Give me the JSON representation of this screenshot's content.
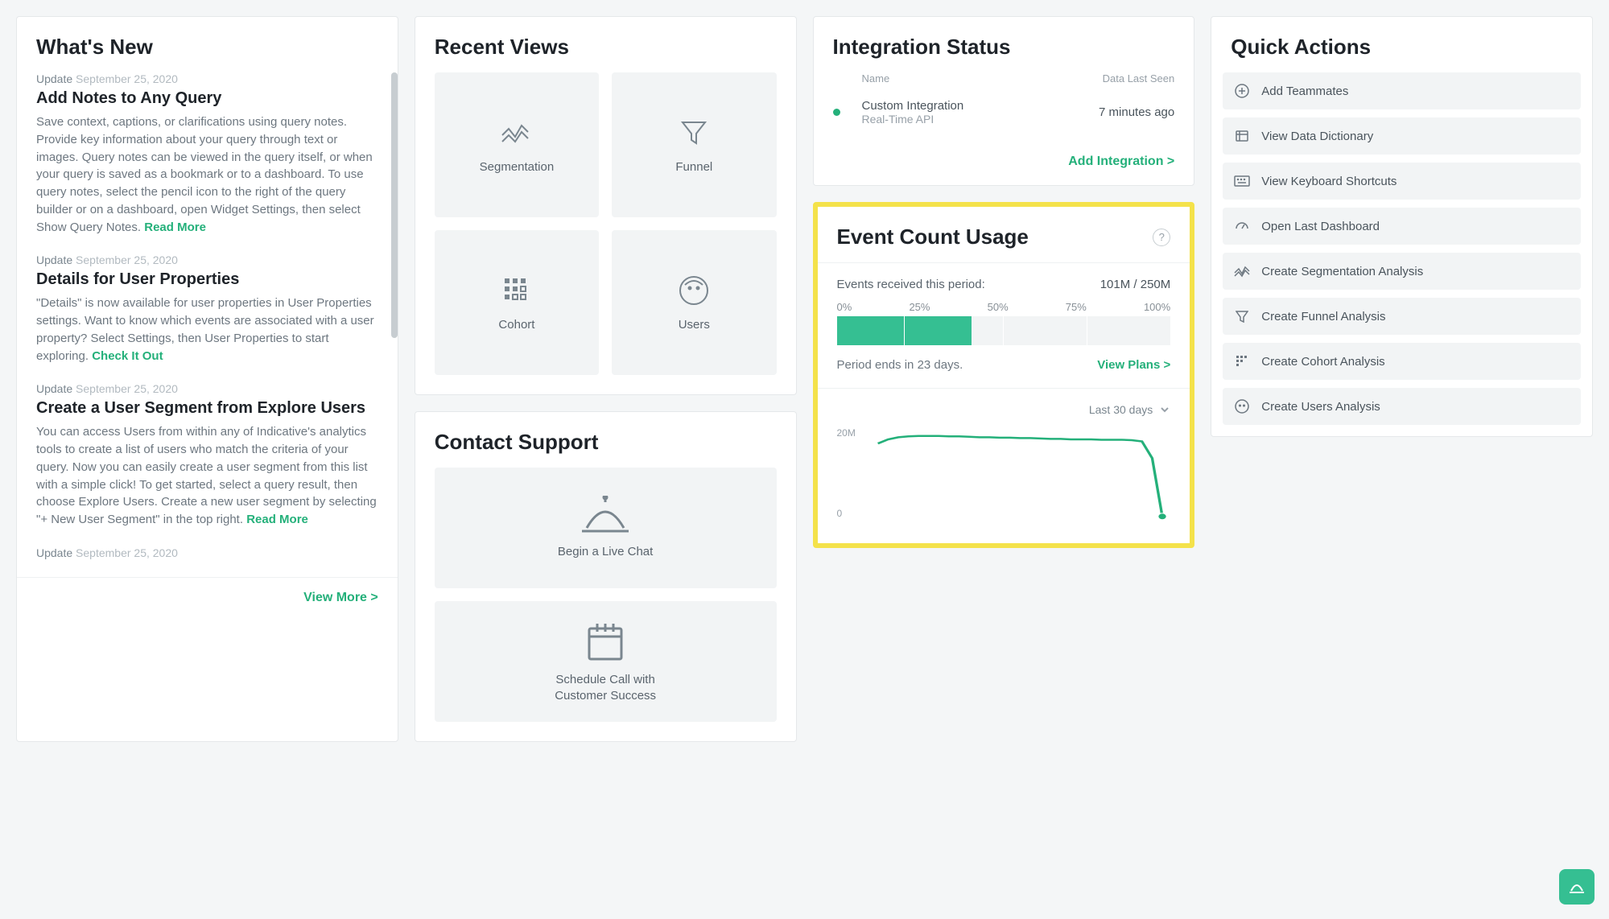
{
  "whats_new": {
    "title": "What's New",
    "view_more": "View More >",
    "items": [
      {
        "tag": "Update",
        "date": "September 25, 2020",
        "title": "Add Notes to Any Query",
        "body": "Save context, captions, or clarifications using query notes. Provide key information about your query through text or images. Query notes can be viewed in the query itself, or when your query is saved as a bookmark or to a dashboard. To use query notes, select the pencil icon to the right of the query builder or on a dashboard, open Widget Settings, then select Show Query Notes. ",
        "link": "Read More"
      },
      {
        "tag": "Update",
        "date": "September 25, 2020",
        "title": "Details for User Properties",
        "body": "\"Details\" is now available for user properties in User Properties settings. Want to know which events are associated with a user property? Select Settings, then User Properties to start exploring. ",
        "link": "Check It Out"
      },
      {
        "tag": "Update",
        "date": "September 25, 2020",
        "title": "Create a User Segment from Explore Users",
        "body": "You can access Users from within any of Indicative's analytics tools to create a list of users who match the criteria of your query. Now you can easily create a user segment from this list with a simple click! To get started, select a query result, then choose Explore Users. Create a new user segment by selecting \"+ New User Segment\" in the top right.  ",
        "link": "Read More"
      },
      {
        "tag": "Update",
        "date": "September 25, 2020",
        "title": "",
        "body": "",
        "link": ""
      }
    ]
  },
  "recent_views": {
    "title": "Recent Views",
    "tiles": [
      {
        "label": "Segmentation"
      },
      {
        "label": "Funnel"
      },
      {
        "label": "Cohort"
      },
      {
        "label": "Users"
      }
    ]
  },
  "contact_support": {
    "title": "Contact Support",
    "live_chat": "Begin a Live Chat",
    "schedule_line1": "Schedule Call with",
    "schedule_line2": "Customer Success"
  },
  "integration_status": {
    "title": "Integration Status",
    "col_name": "Name",
    "col_data": "Data Last Seen",
    "rows": [
      {
        "name": "Custom Integration",
        "sub": "Real-Time API",
        "time": "7 minutes ago"
      }
    ],
    "add": "Add Integration >"
  },
  "event_usage": {
    "title": "Event Count Usage",
    "events_label": "Events received this period:",
    "events_value": "101M / 250M",
    "ticks": [
      "0%",
      "25%",
      "50%",
      "75%",
      "100%"
    ],
    "fill_percent": 40.4,
    "period_text": "Period ends in 23 days.",
    "view_plans": "View Plans >",
    "range_label": "Last 30 days"
  },
  "chart_data": {
    "type": "line",
    "title": "",
    "xlabel": "",
    "ylabel": "",
    "ylim": [
      0,
      22
    ],
    "y_ticks": [
      "20M",
      "0"
    ],
    "x": [
      0,
      1,
      2,
      3,
      4,
      5,
      6,
      7,
      8,
      9,
      10,
      11,
      12,
      13,
      14,
      15,
      16,
      17,
      18,
      19,
      20,
      21,
      22,
      23,
      24,
      25,
      26,
      27,
      28
    ],
    "values": [
      18.5,
      19.5,
      20.0,
      20.2,
      20.3,
      20.3,
      20.3,
      20.2,
      20.2,
      20.1,
      20.0,
      20.0,
      19.9,
      19.9,
      19.8,
      19.8,
      19.7,
      19.6,
      19.6,
      19.5,
      19.5,
      19.5,
      19.4,
      19.4,
      19.4,
      19.3,
      19.0,
      15.0,
      1.0
    ]
  },
  "quick_actions": {
    "title": "Quick Actions",
    "items": [
      "Add Teammates",
      "View Data Dictionary",
      "View Keyboard Shortcuts",
      "Open Last Dashboard",
      "Create Segmentation Analysis",
      "Create Funnel Analysis",
      "Create Cohort Analysis",
      "Create Users Analysis"
    ]
  }
}
